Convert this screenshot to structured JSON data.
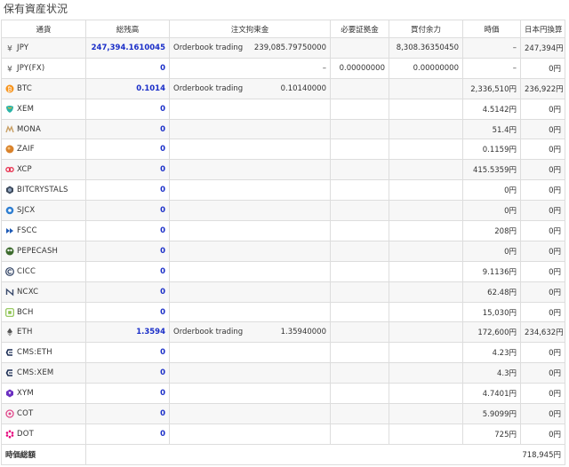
{
  "title": "保有資産状況",
  "headers": {
    "currency": "通貨",
    "balance": "総残高",
    "order_lock": "注文拘束金",
    "margin": "必要証拠金",
    "buyable": "買付余力",
    "price": "時価",
    "jpy_value": "日本円換算"
  },
  "rows": [
    {
      "currency": "JPY",
      "icon": "yen-icon",
      "balance": "247,394.1610045",
      "order_label": "Orderbook trading",
      "order_amount": "239,085.79750000",
      "margin": "",
      "buyable": "8,308.36350450",
      "price": "–",
      "jpy": "247,394円"
    },
    {
      "currency": "JPY(FX)",
      "icon": "yen-icon",
      "balance": "0",
      "order_label": "",
      "order_amount": "–",
      "margin": "0.00000000",
      "buyable": "0.00000000",
      "price": "–",
      "jpy": "0円"
    },
    {
      "currency": "BTC",
      "icon": "bitcoin-icon",
      "balance": "0.1014",
      "order_label": "Orderbook trading",
      "order_amount": "0.10140000",
      "margin": "",
      "buyable": "",
      "price": "2,336,510円",
      "jpy": "236,922円"
    },
    {
      "currency": "XEM",
      "icon": "xem-icon",
      "balance": "0",
      "order_label": "",
      "order_amount": "",
      "margin": "",
      "buyable": "",
      "price": "4.5142円",
      "jpy": "0円"
    },
    {
      "currency": "MONA",
      "icon": "mona-icon",
      "balance": "0",
      "order_label": "",
      "order_amount": "",
      "margin": "",
      "buyable": "",
      "price": "51.4円",
      "jpy": "0円"
    },
    {
      "currency": "ZAIF",
      "icon": "zaif-icon",
      "balance": "0",
      "order_label": "",
      "order_amount": "",
      "margin": "",
      "buyable": "",
      "price": "0.1159円",
      "jpy": "0円"
    },
    {
      "currency": "XCP",
      "icon": "xcp-icon",
      "balance": "0",
      "order_label": "",
      "order_amount": "",
      "margin": "",
      "buyable": "",
      "price": "415.5359円",
      "jpy": "0円"
    },
    {
      "currency": "BITCRYSTALS",
      "icon": "bitcrystals-icon",
      "balance": "0",
      "order_label": "",
      "order_amount": "",
      "margin": "",
      "buyable": "",
      "price": "0円",
      "jpy": "0円"
    },
    {
      "currency": "SJCX",
      "icon": "sjcx-icon",
      "balance": "0",
      "order_label": "",
      "order_amount": "",
      "margin": "",
      "buyable": "",
      "price": "0円",
      "jpy": "0円"
    },
    {
      "currency": "FSCC",
      "icon": "fscc-icon",
      "balance": "0",
      "order_label": "",
      "order_amount": "",
      "margin": "",
      "buyable": "",
      "price": "208円",
      "jpy": "0円"
    },
    {
      "currency": "PEPECASH",
      "icon": "pepecash-icon",
      "balance": "0",
      "order_label": "",
      "order_amount": "",
      "margin": "",
      "buyable": "",
      "price": "0円",
      "jpy": "0円"
    },
    {
      "currency": "CICC",
      "icon": "cicc-icon",
      "balance": "0",
      "order_label": "",
      "order_amount": "",
      "margin": "",
      "buyable": "",
      "price": "9.1136円",
      "jpy": "0円"
    },
    {
      "currency": "NCXC",
      "icon": "ncxc-icon",
      "balance": "0",
      "order_label": "",
      "order_amount": "",
      "margin": "",
      "buyable": "",
      "price": "62.48円",
      "jpy": "0円"
    },
    {
      "currency": "BCH",
      "icon": "bch-icon",
      "balance": "0",
      "order_label": "",
      "order_amount": "",
      "margin": "",
      "buyable": "",
      "price": "15,030円",
      "jpy": "0円"
    },
    {
      "currency": "ETH",
      "icon": "ethereum-icon",
      "balance": "1.3594",
      "order_label": "Orderbook trading",
      "order_amount": "1.35940000",
      "margin": "",
      "buyable": "",
      "price": "172,600円",
      "jpy": "234,632円"
    },
    {
      "currency": "CMS:ETH",
      "icon": "cms-icon",
      "balance": "0",
      "order_label": "",
      "order_amount": "",
      "margin": "",
      "buyable": "",
      "price": "4.23円",
      "jpy": "0円"
    },
    {
      "currency": "CMS:XEM",
      "icon": "cms-icon",
      "balance": "0",
      "order_label": "",
      "order_amount": "",
      "margin": "",
      "buyable": "",
      "price": "4.3円",
      "jpy": "0円"
    },
    {
      "currency": "XYM",
      "icon": "xym-icon",
      "balance": "0",
      "order_label": "",
      "order_amount": "",
      "margin": "",
      "buyable": "",
      "price": "4.7401円",
      "jpy": "0円"
    },
    {
      "currency": "COT",
      "icon": "cot-icon",
      "balance": "0",
      "order_label": "",
      "order_amount": "",
      "margin": "",
      "buyable": "",
      "price": "5.9099円",
      "jpy": "0円"
    },
    {
      "currency": "DOT",
      "icon": "polkadot-icon",
      "balance": "0",
      "order_label": "",
      "order_amount": "",
      "margin": "",
      "buyable": "",
      "price": "725円",
      "jpy": "0円"
    }
  ],
  "total": {
    "label": "時価総額",
    "value": "718,945円"
  }
}
